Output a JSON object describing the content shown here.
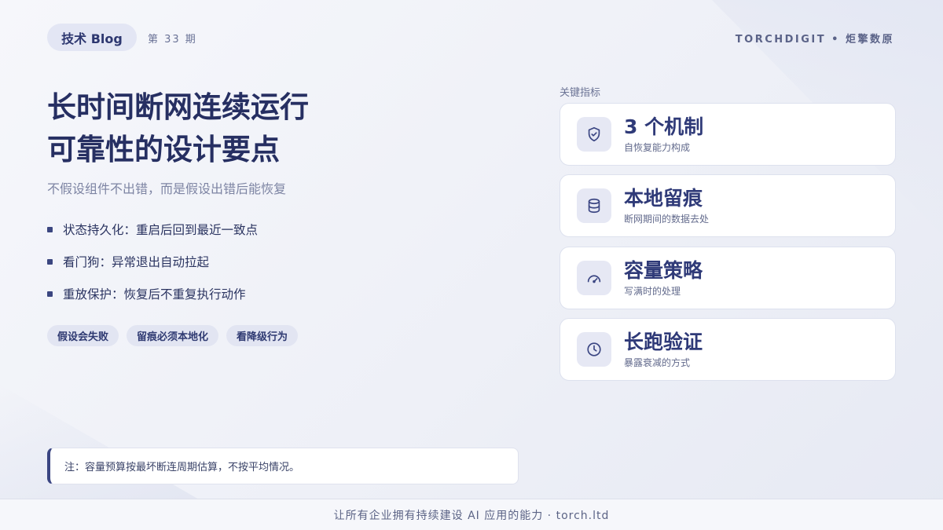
{
  "header": {
    "tag": "技术 Blog",
    "issue": "第 33 期",
    "brand": "TORCHDIGIT • 炬擎数原"
  },
  "main": {
    "title_line1": "长时间断网连续运行",
    "title_line2": "可靠性的设计要点",
    "subtitle": "不假设组件不出错，而是假设出错后能恢复",
    "bullets": [
      "状态持久化：重启后回到最近一致点",
      "看门狗：异常退出自动拉起",
      "重放保护：恢复后不重复执行动作"
    ],
    "chips": [
      "假设会失败",
      "留痕必须本地化",
      "看降级行为"
    ],
    "note": "注：容量预算按最坏断连周期估算，不按平均情况。"
  },
  "metrics": {
    "label": "关键指标",
    "cards": [
      {
        "headline": "3 个机制",
        "sub": "自恢复能力构成",
        "icon": "shield-check-icon"
      },
      {
        "headline": "本地留痕",
        "sub": "断网期间的数据去处",
        "icon": "database-icon"
      },
      {
        "headline": "容量策略",
        "sub": "写满时的处理",
        "icon": "gauge-icon"
      },
      {
        "headline": "长跑验证",
        "sub": "暴露衰减的方式",
        "icon": "clock-icon"
      }
    ]
  },
  "footer": {
    "text": "让所有企业拥有持续建设 AI 应用的能力  ·  torch.ltd"
  },
  "colors": {
    "accent": "#2f3a78",
    "background": "#f1f3f8",
    "chip_bg": "#e2e5f2"
  }
}
